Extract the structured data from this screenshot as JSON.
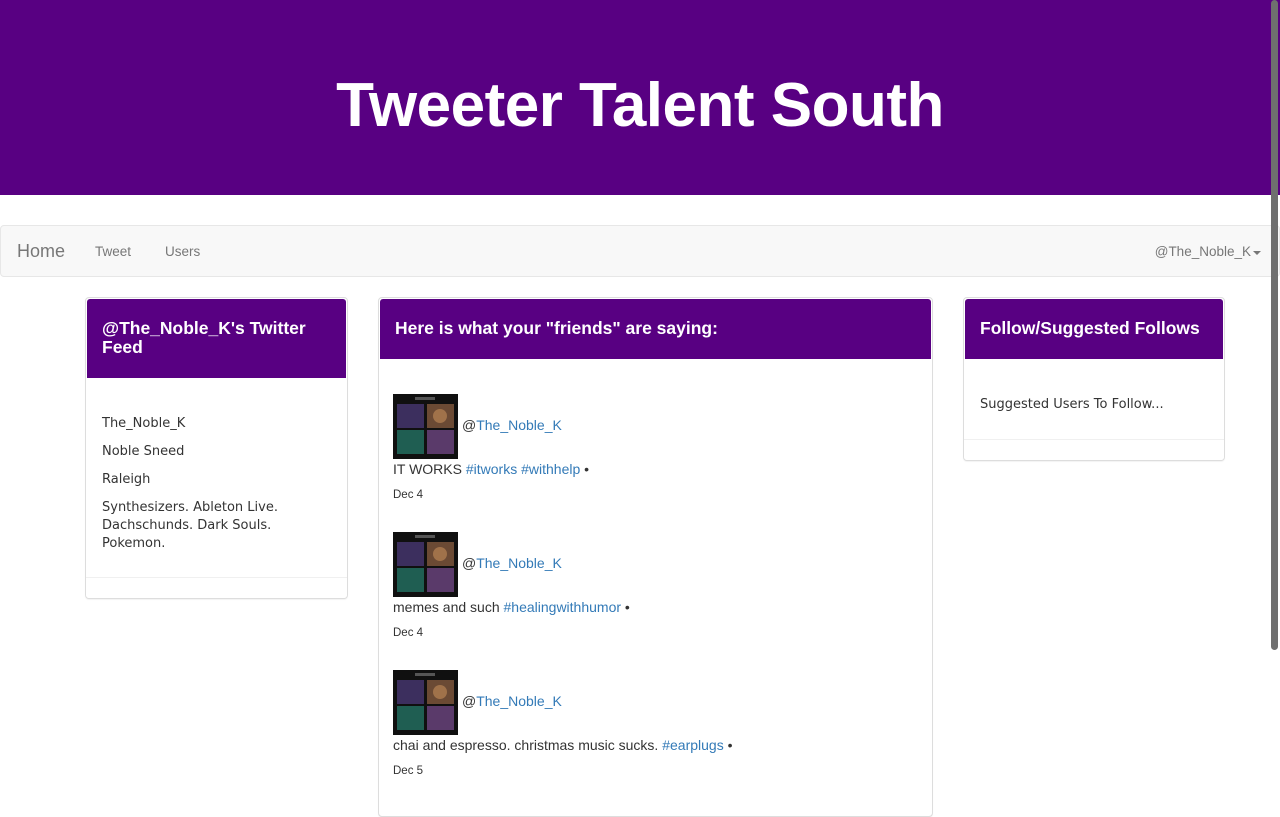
{
  "header": {
    "title": "Tweeter Talent South"
  },
  "nav": {
    "brand": "Home",
    "links": [
      "Tweet",
      "Users"
    ],
    "user": "@The_Noble_K"
  },
  "feed_panel": {
    "title": "@The_Noble_K's Twitter Feed",
    "username": "The_Noble_K",
    "name": "Noble Sneed",
    "location": "Raleigh",
    "bio": "Synthesizers. Ableton Live. Dachschunds. Dark Souls. Pokemon."
  },
  "friends_panel": {
    "title": "Here is what your \"friends\" are saying:",
    "tweets": [
      {
        "at": "@",
        "handle": "The_Noble_K",
        "text": "IT WORKS",
        "hashtags": [
          "#itworks",
          "#withhelp"
        ],
        "sep": "•",
        "date": "Dec 4"
      },
      {
        "at": "@",
        "handle": "The_Noble_K",
        "text": "memes and such",
        "hashtags": [
          "#healingwithhumor"
        ],
        "sep": "•",
        "date": "Dec 4"
      },
      {
        "at": "@",
        "handle": "The_Noble_K",
        "text": "chai and espresso. christmas music sucks.",
        "hashtags": [
          "#earplugs"
        ],
        "sep": "•",
        "date": "Dec 5"
      }
    ]
  },
  "suggest_panel": {
    "title": "Follow/Suggested Follows",
    "subtitle": "Suggested Users To Follow..."
  },
  "colors": {
    "brand_purple": "#580082",
    "link_blue": "#337ab7",
    "navbar_bg": "#f8f8f8"
  }
}
